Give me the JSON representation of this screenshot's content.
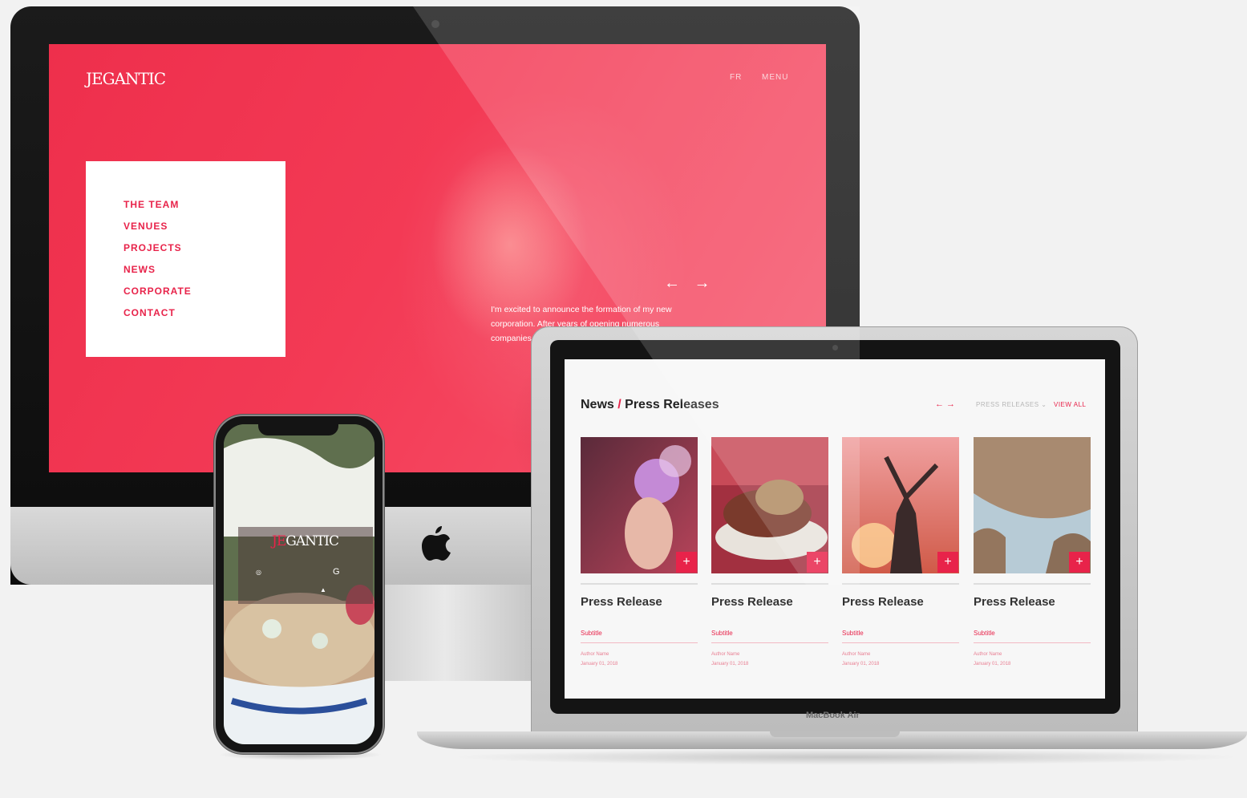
{
  "imac": {
    "logo": "JEGANTIC",
    "nav": {
      "lang": "FR",
      "menu": "MENU"
    },
    "menu_items": [
      "THE TEAM",
      "VENUES",
      "PROJECTS",
      "NEWS",
      "CORPORATE",
      "CONTACT"
    ],
    "slider_arrows": "← →",
    "quote": "I'm excited to announce the formation of my new corporation. After years of opening numerous companies... to bars and"
  },
  "macbook": {
    "brand": "MacBook Air",
    "news": {
      "title_left": "News",
      "slash": "/",
      "title_right": "Press Releases",
      "arrows": "← →",
      "filter": "PRESS RELEASES ⌄",
      "view_all": "VIEW ALL"
    },
    "cards": [
      {
        "title": "Press Release",
        "subtitle": "Subtitle",
        "author": "Author Name",
        "date": "January 01, 2018",
        "plus": "+"
      },
      {
        "title": "Press Release",
        "subtitle": "Subtitle",
        "author": "Author Name",
        "date": "January 01, 2018",
        "plus": "+"
      },
      {
        "title": "Press Release",
        "subtitle": "Subtitle",
        "author": "Author Name",
        "date": "January 01, 2018",
        "plus": "+"
      },
      {
        "title": "Press Release",
        "subtitle": "Subtitle",
        "author": "Author Name",
        "date": "January 01, 2018",
        "plus": "+"
      }
    ]
  },
  "phone": {
    "logo_accent": "JE",
    "logo_rest": "GANTIC"
  },
  "colors": {
    "accent": "#e8234a",
    "imac_screen": "#f33a55"
  }
}
